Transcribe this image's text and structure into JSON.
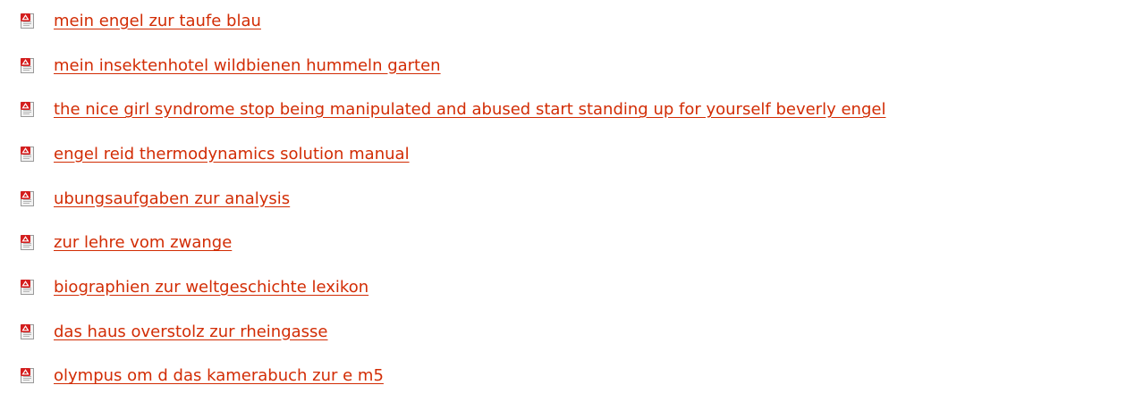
{
  "icon_name": "pdf-file-icon",
  "link_color": "#d22c04",
  "links": [
    {
      "label": "mein engel zur taufe blau"
    },
    {
      "label": "mein insektenhotel wildbienen hummeln garten"
    },
    {
      "label": "the nice girl syndrome stop being manipulated and abused start standing up for yourself beverly engel"
    },
    {
      "label": "engel reid thermodynamics solution manual"
    },
    {
      "label": "ubungsaufgaben zur analysis"
    },
    {
      "label": "zur lehre vom zwange"
    },
    {
      "label": "biographien zur weltgeschichte lexikon"
    },
    {
      "label": "das haus overstolz zur rheingasse"
    },
    {
      "label": "olympus om d das kamerabuch zur e m5"
    }
  ]
}
